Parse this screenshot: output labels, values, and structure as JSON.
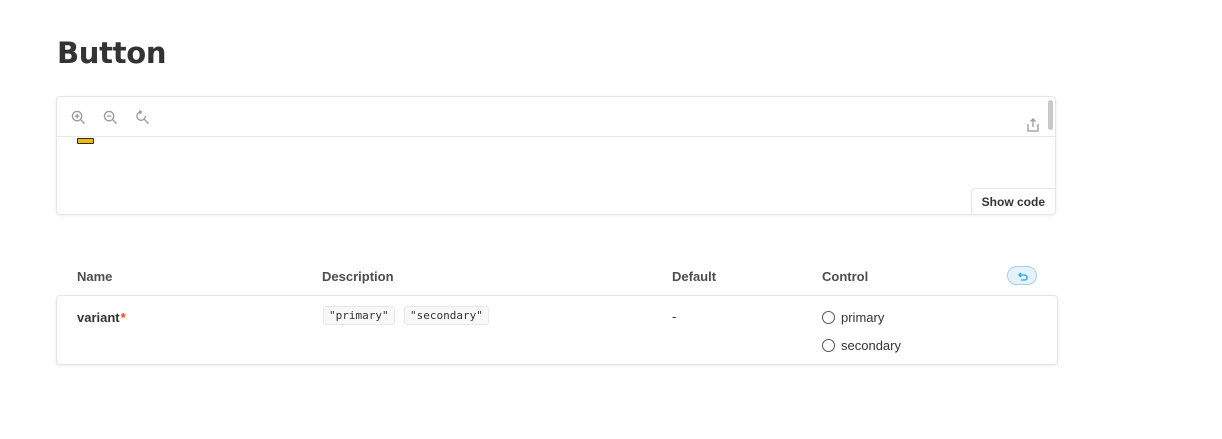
{
  "page": {
    "title": "Button"
  },
  "preview": {
    "toolbar": {
      "zoom_in_icon": "zoom-in-icon",
      "zoom_out_icon": "zoom-out-icon",
      "reset_zoom_icon": "reset-zoom-icon",
      "share_icon": "share-icon"
    },
    "show_code_label": "Show code",
    "story_button": {
      "fill": "#f2b705",
      "border": "#2b2b2b"
    }
  },
  "args_table": {
    "headers": {
      "name": "Name",
      "description": "Description",
      "default": "Default",
      "control": "Control"
    },
    "reset_icon": "undo-icon",
    "rows": [
      {
        "name": "variant",
        "required_mark": "*",
        "description_values": [
          "\"primary\"",
          "\"secondary\""
        ],
        "default": "-",
        "control": {
          "type": "radio",
          "options": [
            "primary",
            "secondary"
          ]
        }
      }
    ]
  },
  "colors": {
    "accent": "#1ea7fd",
    "required": "#ff4400"
  }
}
